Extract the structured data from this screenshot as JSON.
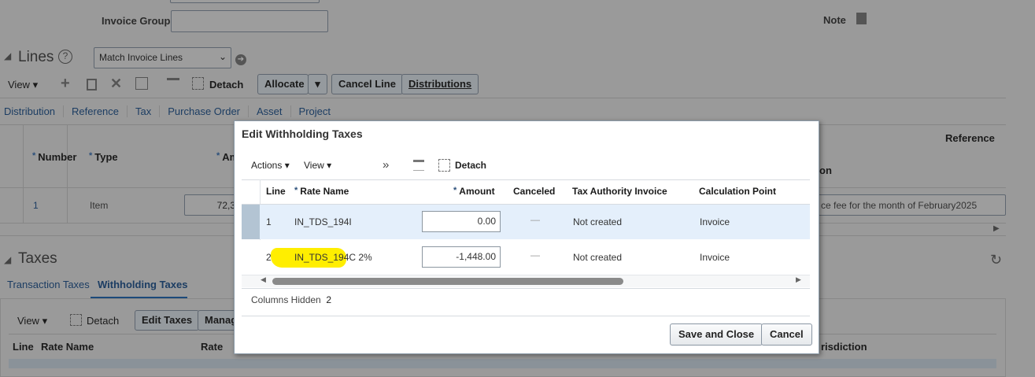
{
  "header": {
    "invoice_group_label": "Invoice Group",
    "invoice_group_value": "",
    "note_label": "Note"
  },
  "lines": {
    "title": "Lines",
    "match_select": "Match Invoice Lines",
    "view_label": "View",
    "detach_label": "Detach",
    "allocate_label": "Allocate",
    "cancel_line_label": "Cancel Line",
    "distributions_label": "Distributions",
    "tabs": [
      "Distribution",
      "Reference",
      "Tax",
      "Purchase Order",
      "Asset",
      "Project"
    ],
    "columns": {
      "number": "Number",
      "type": "Type",
      "amount": "Am",
      "reference": "Reference",
      "description": "on"
    },
    "row": {
      "number": "1",
      "type": "Item",
      "amount": "72,3",
      "description": "ce fee for the month of February2025"
    }
  },
  "taxes": {
    "title": "Taxes",
    "tabs": [
      "Transaction Taxes",
      "Withholding Taxes"
    ],
    "view_label": "View",
    "detach_label": "Detach",
    "edit_taxes_label": "Edit Taxes",
    "manage_label": "Manag",
    "columns": {
      "line": "Line",
      "rate_name": "Rate Name",
      "rate": "Rate",
      "jurisdiction": "risdiction"
    }
  },
  "dialog": {
    "title": "Edit Withholding Taxes",
    "actions_label": "Actions",
    "view_label": "View",
    "detach_label": "Detach",
    "columns": {
      "line": "Line",
      "rate_name": "Rate Name",
      "amount": "Amount",
      "canceled": "Canceled",
      "tax_authority_invoice": "Tax Authority Invoice",
      "calculation_point": "Calculation Point"
    },
    "rows": [
      {
        "line": "1",
        "rate_name": "IN_TDS_194I",
        "amount": "0.00",
        "canceled": "—",
        "tax_authority_invoice": "Not created",
        "calculation_point": "Invoice"
      },
      {
        "line": "2",
        "rate_name": "IN_TDS_194C 2%",
        "amount": "-1,448.00",
        "canceled": "—",
        "tax_authority_invoice": "Not created",
        "calculation_point": "Invoice"
      }
    ],
    "columns_hidden_label": "Columns Hidden",
    "columns_hidden_count": "2",
    "save_close_label": "Save and Close",
    "cancel_label": "Cancel"
  },
  "colors": {
    "highlight": "#ffee00",
    "selected_row": "#e4effb",
    "overlay": "#9a9a9a"
  }
}
